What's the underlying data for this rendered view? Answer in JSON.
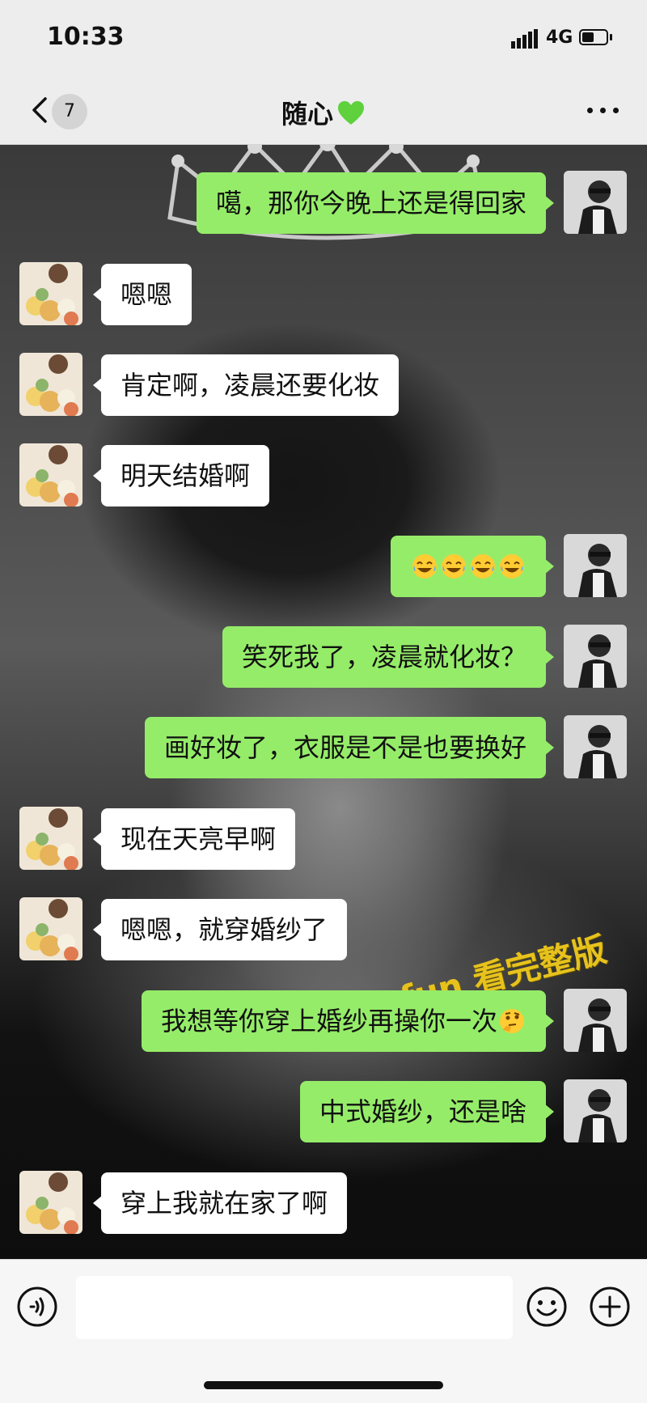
{
  "status_bar": {
    "time": "10:33",
    "network": "4G"
  },
  "nav": {
    "back_count": "7",
    "title": "随心",
    "title_emoji": "green-heart"
  },
  "watermark": "91cg.fun 看完整版",
  "messages": [
    {
      "side": "me",
      "text": "噶，那你今晚上还是得回家"
    },
    {
      "side": "them",
      "text": "嗯嗯"
    },
    {
      "side": "them",
      "text": "肯定啊，凌晨还要化妆"
    },
    {
      "side": "them",
      "text": "明天结婚啊"
    },
    {
      "side": "me",
      "text": "",
      "emoji": [
        "laughing-tears-emoji",
        "laughing-tears-emoji",
        "laughing-tears-emoji",
        "laughing-tears-emoji"
      ]
    },
    {
      "side": "me",
      "text": "笑死我了，凌晨就化妆？"
    },
    {
      "side": "me",
      "text": "画好妆了，衣服是不是也要换好"
    },
    {
      "side": "them",
      "text": "现在天亮早啊"
    },
    {
      "side": "them",
      "text": "嗯嗯，就穿婚纱了"
    },
    {
      "side": "me",
      "text": "我想等你穿上婚纱再操你一次",
      "emoji": [
        "thinking-face-emoji"
      ]
    },
    {
      "side": "me",
      "text": "中式婚纱，还是啥"
    },
    {
      "side": "them",
      "text": "穿上我就在家了啊"
    }
  ],
  "input": {
    "placeholder": ""
  },
  "colors": {
    "my_bubble": "#95ec69",
    "their_bubble": "#ffffff",
    "bar_bg": "#ededed"
  }
}
